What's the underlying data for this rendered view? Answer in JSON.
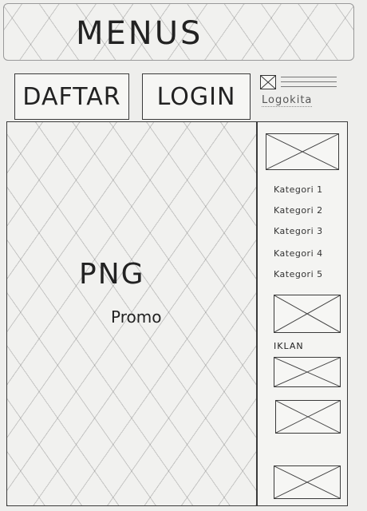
{
  "header": {
    "title": "MENUS"
  },
  "nav": {
    "daftar_label": "DAFTAR",
    "login_label": "LOGIN"
  },
  "logo": {
    "text": "Logokita"
  },
  "promo": {
    "png_label": "PNG",
    "promo_label": "Promo"
  },
  "sidebar": {
    "categories": [
      "Kategori 1",
      "Kategori 2",
      "Kategori 3",
      "Kategori 4",
      "Kategori 5"
    ],
    "ads_label": "IKLAN"
  }
}
